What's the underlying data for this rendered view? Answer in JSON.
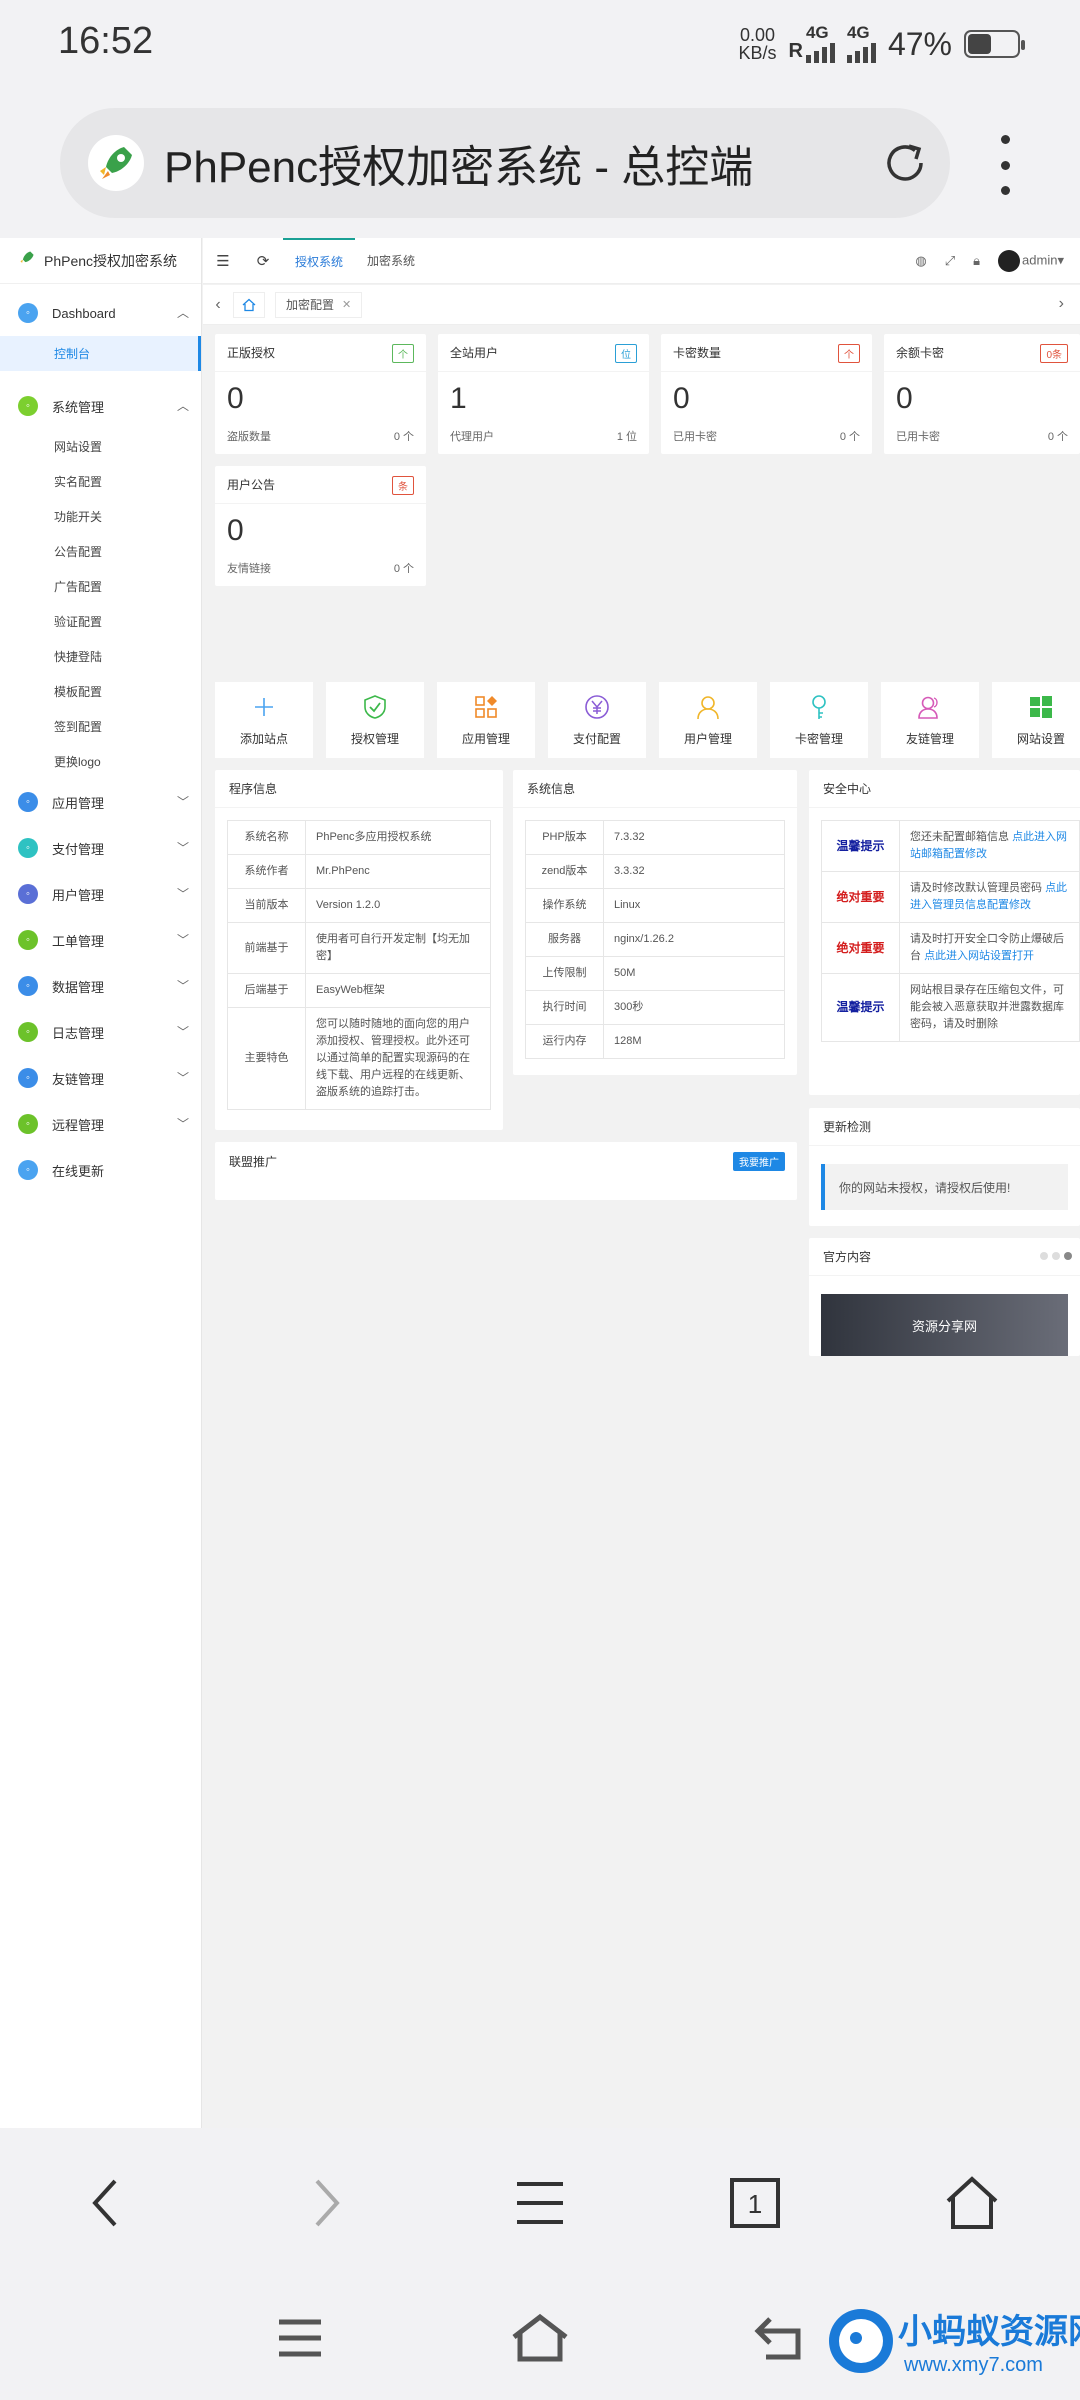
{
  "status_bar": {
    "time": "16:52",
    "speed_value": "0.00",
    "speed_unit": "KB/s",
    "net1": "4G",
    "net1_prefix": "R",
    "net2": "4G",
    "battery_pct": "47%",
    "battery_level": 0.47
  },
  "browser": {
    "page_title": "PhPenc授权加密系统 - 总控端",
    "reload_icon": "reload-icon",
    "more_icon": "more-vertical-icon"
  },
  "sidebar": {
    "brand": "PhPenc授权加密系统",
    "groups": [
      {
        "label": "Dashboard",
        "color": "#4aa3f0",
        "expanded": true,
        "items": [
          "控制台"
        ]
      },
      {
        "label": "系统管理",
        "color": "#7ccf2f",
        "expanded": true,
        "items": [
          "网站设置",
          "实名配置",
          "功能开关",
          "公告配置",
          "广告配置",
          "验证配置",
          "快捷登陆",
          "模板配置",
          "签到配置",
          "更换logo"
        ]
      },
      {
        "label": "应用管理",
        "color": "#3b8de8"
      },
      {
        "label": "支付管理",
        "color": "#2ec2c2"
      },
      {
        "label": "用户管理",
        "color": "#5a6fd6"
      },
      {
        "label": "工单管理",
        "color": "#6cc22a"
      },
      {
        "label": "数据管理",
        "color": "#3b8de8"
      },
      {
        "label": "日志管理",
        "color": "#6cc22a"
      },
      {
        "label": "友链管理",
        "color": "#3b8de8"
      },
      {
        "label": "远程管理",
        "color": "#6cc22a"
      },
      {
        "label": "在线更新",
        "color": "#4aa3f0"
      }
    ]
  },
  "topbar": {
    "tabs": [
      "授权系统",
      "加密系统"
    ],
    "user": "admin"
  },
  "tabsrow": {
    "open_tab": "加密配置"
  },
  "stats": [
    {
      "title": "正版授权",
      "badge": "个",
      "badge_color": "#5cb85c",
      "value": "0",
      "foot_label": "盗版数量",
      "foot_value": "0 个"
    },
    {
      "title": "全站用户",
      "badge": "位",
      "badge_color": "#2a9fd6",
      "value": "1",
      "foot_label": "代理用户",
      "foot_value": "1 位"
    },
    {
      "title": "卡密数量",
      "badge": "个",
      "badge_color": "#e0533d",
      "value": "0",
      "foot_label": "已用卡密",
      "foot_value": "0 个"
    },
    {
      "title": "余额卡密",
      "badge": "0条",
      "badge_color": "#e0533d",
      "value": "0",
      "foot_label": "已用卡密",
      "foot_value": "0 个"
    },
    {
      "title": "用户公告",
      "badge": "条",
      "badge_color": "#e0533d",
      "value": "0",
      "foot_label": "友情链接",
      "foot_value": "0 个"
    }
  ],
  "quick": [
    {
      "label": "添加站点",
      "icon": "plus-icon",
      "color": "#4aa3f0"
    },
    {
      "label": "授权管理",
      "icon": "shield-check-icon",
      "color": "#3cb84a"
    },
    {
      "label": "应用管理",
      "icon": "apps-grid-icon",
      "color": "#f08a2a"
    },
    {
      "label": "支付配置",
      "icon": "yen-icon",
      "color": "#8a5cd6"
    },
    {
      "label": "用户管理",
      "icon": "user-icon",
      "color": "#f0b62a"
    },
    {
      "label": "卡密管理",
      "icon": "key-icon",
      "color": "#2ec2c2"
    },
    {
      "label": "友链管理",
      "icon": "users-icon",
      "color": "#d65ab8"
    },
    {
      "label": "网站设置",
      "icon": "windows-icon",
      "color": "#3cb84a"
    }
  ],
  "program_info": {
    "title": "程序信息",
    "rows": [
      {
        "k": "系统名称",
        "v": "PhPenc多应用授权系统"
      },
      {
        "k": "系统作者",
        "v": "Mr.PhPenc"
      },
      {
        "k": "当前版本",
        "v": "Version 1.2.0"
      },
      {
        "k": "前端基于",
        "v": "使用者可自行开发定制【均无加密】"
      },
      {
        "k": "后端基于",
        "v": "EasyWeb框架"
      },
      {
        "k": "主要特色",
        "v": "您可以随时随地的面向您的用户添加授权、管理授权。此外还可以通过简单的配置实现源码的在线下载、用户远程的在线更新、盗版系统的追踪打击。"
      }
    ]
  },
  "system_info": {
    "title": "系统信息",
    "rows": [
      {
        "k": "PHP版本",
        "v": "7.3.32"
      },
      {
        "k": "zend版本",
        "v": "3.3.32"
      },
      {
        "k": "操作系统",
        "v": "Linux"
      },
      {
        "k": "服务器",
        "v": "nginx/1.26.2"
      },
      {
        "k": "上传限制",
        "v": "50M"
      },
      {
        "k": "执行时间",
        "v": "300秒"
      },
      {
        "k": "运行内存",
        "v": "128M"
      }
    ]
  },
  "security": {
    "title": "安全中心",
    "rows": [
      {
        "k": "温馨提示",
        "kind": "blue",
        "text": "您还未配置邮箱信息 ",
        "link": "点此进入网站邮箱配置修改"
      },
      {
        "k": "绝对重要",
        "kind": "red",
        "text": "请及时修改默认管理员密码 ",
        "link": "点此进入管理员信息配置修改"
      },
      {
        "k": "绝对重要",
        "kind": "red",
        "text": "请及时打开安全口令防止爆破后台 ",
        "link": "点此进入网站设置打开"
      },
      {
        "k": "温馨提示",
        "kind": "blue",
        "text": "网站根目录存在压缩包文件，可能会被入恶意获取并泄露数据库密码，请及时删除",
        "link": ""
      }
    ]
  },
  "update": {
    "title": "更新检测",
    "message": "你的网站未授权，请授权后使用!"
  },
  "official": {
    "title": "官方内容",
    "banner": "资源分享网"
  },
  "promo": {
    "title": "联盟推广",
    "button": "我要推广"
  },
  "watermark": {
    "name": "小蚂蚁资源网",
    "url": "www.xmy7.com"
  }
}
